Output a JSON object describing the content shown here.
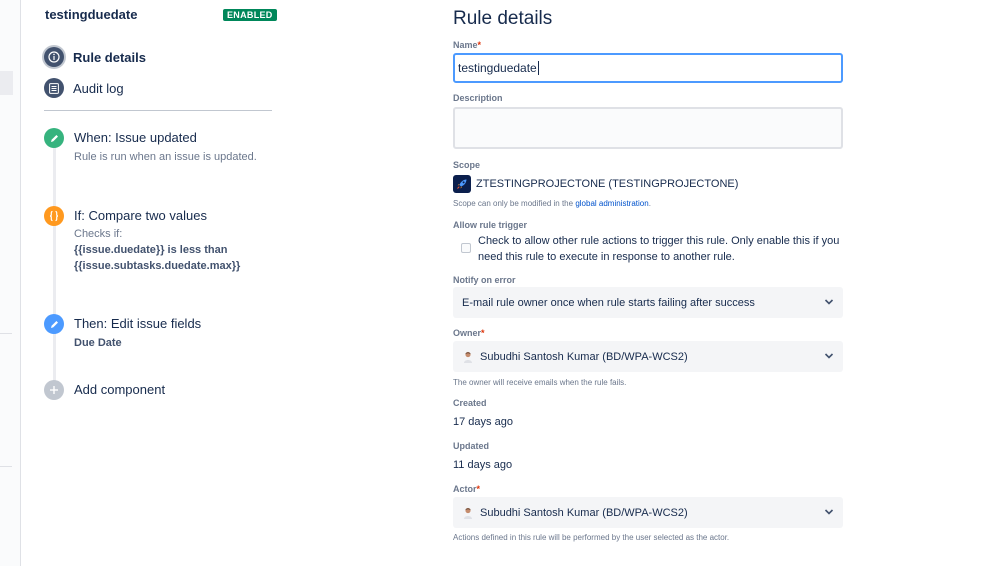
{
  "rule": {
    "name": "testingduedate",
    "status_badge": "ENABLED"
  },
  "nav": [
    {
      "label": "Rule details",
      "icon": "info-icon",
      "active": true
    },
    {
      "label": "Audit log",
      "icon": "list-icon",
      "active": false
    }
  ],
  "steps": [
    {
      "title": "When: Issue updated",
      "icon": "pencil-icon",
      "color": "#36b37e",
      "lines": [
        "Rule is run when an issue is updated."
      ]
    },
    {
      "title": "If: Compare two values",
      "icon": "braces-icon",
      "color": "#ff991f",
      "lines": [
        "Checks if:"
      ],
      "strong_lines": [
        "{{issue.duedate}} is less than",
        "{{issue.subtasks.duedate.max}}"
      ]
    },
    {
      "title": "Then: Edit issue fields",
      "icon": "pencil-icon",
      "color": "#4c9aff",
      "strong_lines": [
        "Due Date"
      ]
    },
    {
      "title": "Add component",
      "icon": "plus-icon",
      "color": "#c1c7d0"
    }
  ],
  "details": {
    "heading": "Rule details",
    "name_label": "Name",
    "name_value": "testingduedate",
    "description_label": "Description",
    "description_value": "",
    "scope_label": "Scope",
    "scope_value": "ZTESTINGPROJECTONE (TESTINGPROJECTONE)",
    "scope_note_prefix": "Scope can only be modified in the",
    "scope_note_link": "global administration",
    "scope_note_suffix": ".",
    "allow_trigger_label": "Allow rule trigger",
    "allow_trigger_text": "Check to allow other rule actions to trigger this rule. Only enable this if you need this rule to execute in response to another rule.",
    "allow_trigger_checked": false,
    "notify_label": "Notify on error",
    "notify_value": "E-mail rule owner once when rule starts failing after success",
    "owner_label": "Owner",
    "owner_value": "Subudhi Santosh Kumar (BD/WPA-WCS2)",
    "owner_note": "The owner will receive emails when the rule fails.",
    "created_label": "Created",
    "created_value": "17 days ago",
    "updated_label": "Updated",
    "updated_value": "11 days ago",
    "actor_label": "Actor",
    "actor_value": "Subudhi Santosh Kumar (BD/WPA-WCS2)",
    "actor_note": "Actions defined in this rule will be performed by the user selected as the actor.",
    "required_mark": "*"
  },
  "colors": {
    "accent": "#4c9aff",
    "enabled": "#00875a",
    "required": "#de350b",
    "link": "#0052cc"
  }
}
